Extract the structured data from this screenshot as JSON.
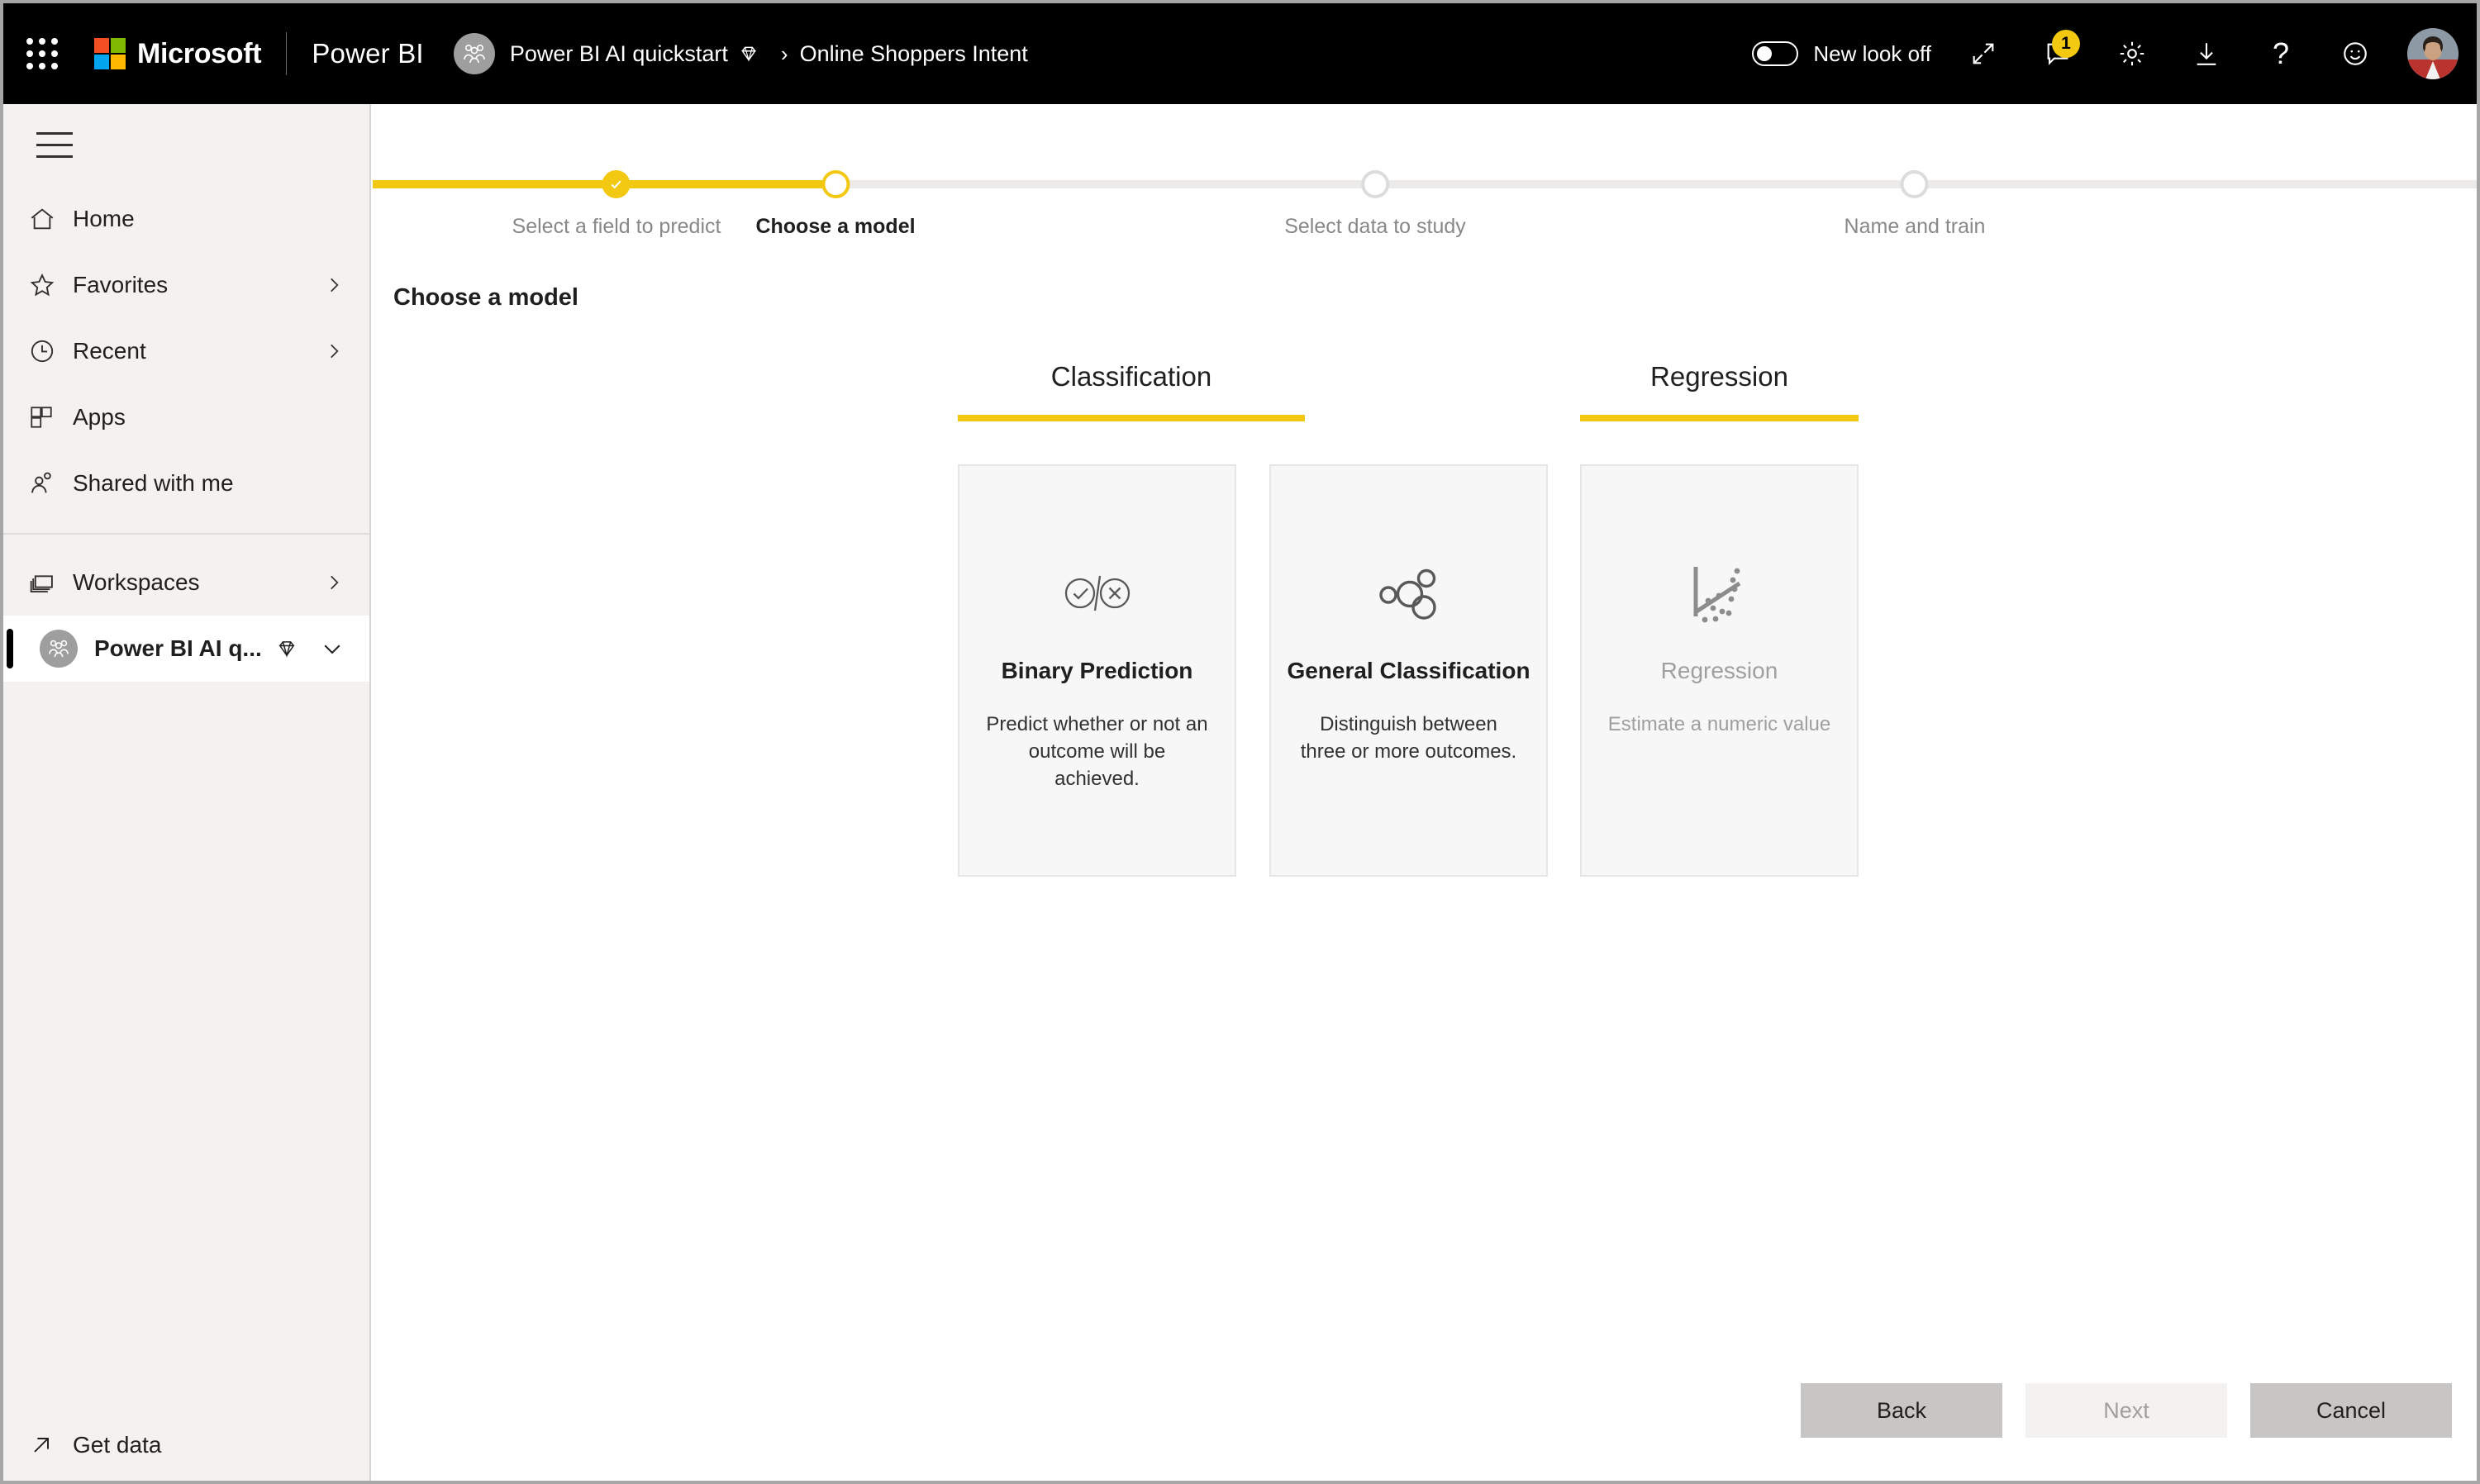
{
  "topbar": {
    "waffle_label": "app-launcher",
    "microsoft_label": "Microsoft",
    "product_name": "Power BI",
    "breadcrumb": {
      "workspace": "Power BI AI quickstart",
      "separator": "›",
      "current": "Online Shoppers Intent"
    },
    "new_look_toggle": {
      "label": "New look off",
      "state": "off"
    },
    "icons": [
      {
        "name": "expand-icon",
        "glyph": "↗"
      },
      {
        "name": "notifications-icon",
        "badge": "1"
      },
      {
        "name": "settings-gear-icon"
      },
      {
        "name": "download-icon"
      },
      {
        "name": "help-icon",
        "glyph": "?"
      },
      {
        "name": "feedback-smiley-icon"
      }
    ],
    "avatar_label": "user-avatar"
  },
  "sidebar": {
    "items": [
      {
        "label": "Home",
        "icon": "home-icon",
        "chevron": false
      },
      {
        "label": "Favorites",
        "icon": "star-icon",
        "chevron": true
      },
      {
        "label": "Recent",
        "icon": "clock-icon",
        "chevron": true
      },
      {
        "label": "Apps",
        "icon": "apps-grid-icon",
        "chevron": false
      },
      {
        "label": "Shared with me",
        "icon": "shared-people-icon",
        "chevron": false
      }
    ],
    "workspaces": {
      "label": "Workspaces",
      "icon": "workspaces-icon",
      "chevron": true
    },
    "active_workspace": {
      "label": "Power BI AI q...",
      "icon": "workspace-avatar-icon",
      "premium_icon": "gem-icon",
      "chevron": "chevron-down-icon"
    },
    "get_data": {
      "label": "Get data",
      "icon": "arrow-up-right-icon"
    }
  },
  "wizard": {
    "page_title": "Choose a model",
    "steps": [
      {
        "label": "Select a field to predict",
        "state": "done"
      },
      {
        "label": "Choose a model",
        "state": "current"
      },
      {
        "label": "Select data to study",
        "state": "pending"
      },
      {
        "label": "Name and train",
        "state": "pending"
      }
    ],
    "categories": [
      {
        "name": "Classification"
      },
      {
        "name": "Regression"
      }
    ],
    "models": [
      {
        "title": "Binary Prediction",
        "description": "Predict whether or not an outcome will be achieved.",
        "icon": "check-slash-x-icon",
        "disabled": false
      },
      {
        "title": "General Classification",
        "description": "Distinguish between three or more outcomes.",
        "icon": "clustered-circles-icon",
        "disabled": false
      },
      {
        "title": "Regression",
        "description": "Estimate a numeric value",
        "icon": "scatter-trend-icon",
        "disabled": true
      }
    ],
    "buttons": {
      "back": "Back",
      "next": "Next",
      "cancel": "Cancel"
    }
  },
  "colors": {
    "brand_yellow": "#F2C811",
    "topbar_black": "#000000",
    "sidebar_gray": "#F3F2F1",
    "card_gray": "#F7F7F7",
    "button_gray": "#C8C6C4",
    "disabled_text": "#A19F9D"
  }
}
